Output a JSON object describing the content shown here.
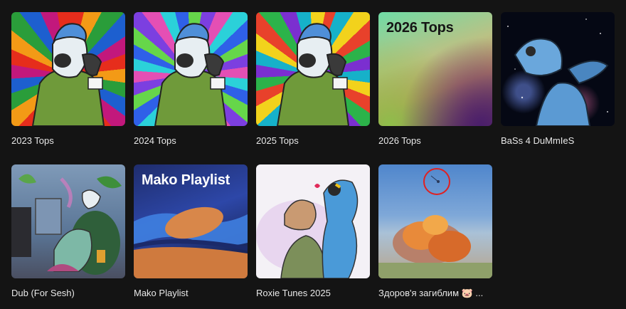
{
  "playlists": [
    {
      "title": "2023 Tops",
      "art": "tie-dye-character-art"
    },
    {
      "title": "2024 Tops",
      "art": "tie-dye-character-art"
    },
    {
      "title": "2025 Tops",
      "art": "tie-dye-character-art"
    },
    {
      "title": "2026 Tops",
      "cover_text": "2026 Tops",
      "art": "gradient-cover"
    },
    {
      "title": "BaSs 4 DuMmIeS",
      "art": "space-character-art"
    },
    {
      "title": "Dub (For Sesh)",
      "art": "room-character-art"
    },
    {
      "title": "Mako Playlist",
      "cover_text": "Mako Playlist",
      "art": "abstract-wave-cover"
    },
    {
      "title": "Roxie Tunes 2025",
      "art": "couple-character-art"
    },
    {
      "title": "Здоров'я загиблим 🐷 ...",
      "art": "explosion-photo"
    }
  ],
  "colors": {
    "background": "#141414",
    "label_text": "#e8e8e8"
  }
}
